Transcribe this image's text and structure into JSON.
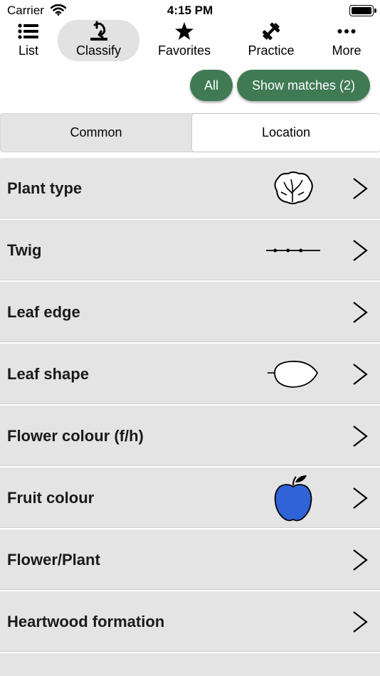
{
  "status": {
    "carrier": "Carrier",
    "time": "4:15 PM"
  },
  "tabs": [
    {
      "label": "List",
      "icon": "list-icon"
    },
    {
      "label": "Classify",
      "icon": "classify-icon"
    },
    {
      "label": "Favorites",
      "icon": "star-icon"
    },
    {
      "label": "Practice",
      "icon": "dumbbell-icon"
    },
    {
      "label": "More",
      "icon": "more-icon"
    }
  ],
  "active_tab": "Classify",
  "filters": {
    "all_label": "All",
    "show_matches_label": "Show matches (2)",
    "accent": "#3f7a55"
  },
  "segments": {
    "common": "Common",
    "location": "Location",
    "selected": "Location"
  },
  "rows": [
    {
      "label": "Plant type",
      "image": "tree-crown-image"
    },
    {
      "label": "Twig",
      "image": "twig-image"
    },
    {
      "label": "Leaf edge",
      "image": ""
    },
    {
      "label": "Leaf shape",
      "image": "oval-leaf-image"
    },
    {
      "label": "Flower colour (f/h)",
      "image": ""
    },
    {
      "label": "Fruit colour",
      "image": "blue-apple-image",
      "color": "#2f63d6"
    },
    {
      "label": "Flower/Plant",
      "image": ""
    },
    {
      "label": "Heartwood formation",
      "image": ""
    }
  ]
}
